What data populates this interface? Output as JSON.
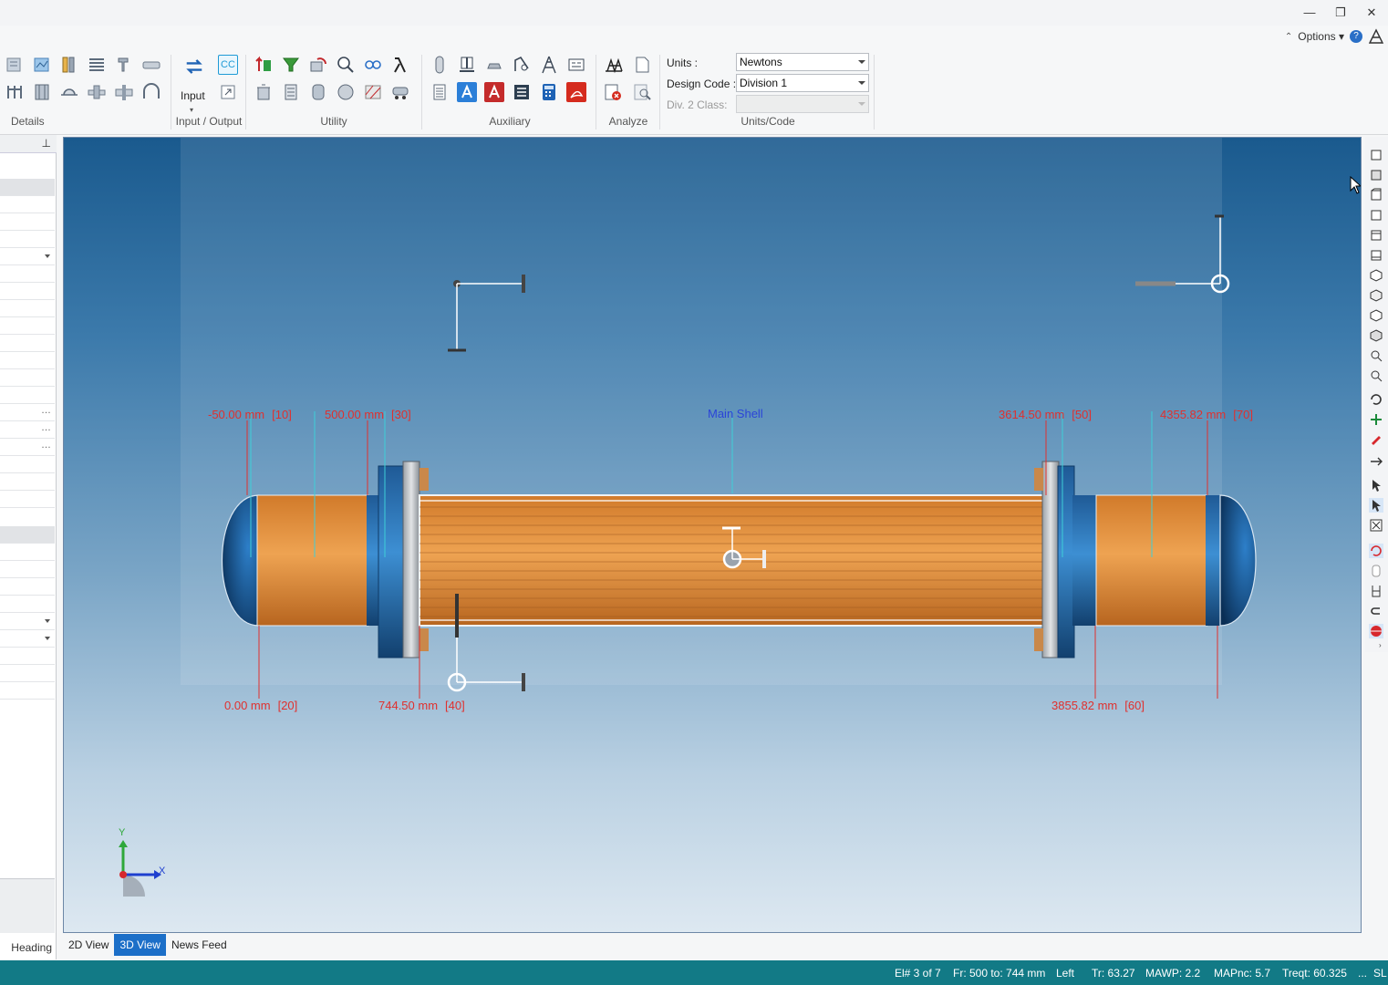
{
  "window": {
    "options_label": "Options",
    "minimize_glyph": "—",
    "restore_glyph": "❐",
    "close_glyph": "✕"
  },
  "ribbon": {
    "groups": {
      "details": "Details",
      "input_output": "Input / Output",
      "utility": "Utility",
      "auxiliary": "Auxiliary",
      "analyze": "Analyze",
      "units_code": "Units/Code"
    },
    "input_button_label": "Input",
    "cc_label": "CC",
    "units_label": "Units :",
    "units_value": "Newtons",
    "design_code_label": "Design Code :",
    "design_code_value": "Division 1",
    "div2_label": "Div. 2 Class:",
    "div2_value": ""
  },
  "left_panel": {
    "heading_tab": "Heading",
    "pin_glyph": "⊥"
  },
  "viewport": {
    "component_label": "Main Shell",
    "dimension_labels": [
      {
        "value": "-50.00 mm",
        "node": "[10]"
      },
      {
        "value": "500.00 mm",
        "node": "[30]"
      },
      {
        "value": "3614.50 mm",
        "node": "[50]"
      },
      {
        "value": "4355.82 mm",
        "node": "[70]"
      },
      {
        "value": "0.00 mm",
        "node": "[20]"
      },
      {
        "value": "744.50 mm",
        "node": "[40]"
      },
      {
        "value": "3855.82 mm",
        "node": "[60]"
      }
    ],
    "axis_y": "Y",
    "axis_x": "X"
  },
  "tabs": [
    {
      "label": "2D View",
      "active": false
    },
    {
      "label": "3D View",
      "active": true
    },
    {
      "label": "News Feed",
      "active": false
    }
  ],
  "status": {
    "element": "El# 3 of 7",
    "from_to": "Fr: 500 to: 744 mm",
    "side": "Left",
    "tr": "Tr: 63.27",
    "mawp": "MAWP: 2.2",
    "mapnc": "MAPnc: 5.7",
    "treqt": "Treqt: 60.325",
    "ellipsis": "...",
    "sl": "SL"
  },
  "colors": {
    "accent": "#1c6fc8",
    "status_bar": "#127a86",
    "dimension_text": "#e0302e",
    "component_text": "#2a44d8",
    "shell_orange": "#e0913e",
    "nozzle_blue": "#2f7dbf"
  }
}
